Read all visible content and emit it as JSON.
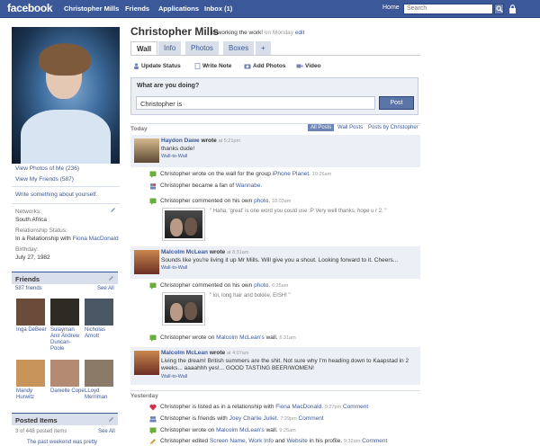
{
  "topbar": {
    "logo": "facebook",
    "nav": [
      "Christopher Mills",
      "Friends",
      "Applications",
      "Inbox (1)"
    ],
    "home": "Home",
    "search_placeholder": "Search"
  },
  "left": {
    "links": [
      "View Photos of Me (236)",
      "View My Friends (587)"
    ],
    "write_about": "Write something about yourself.",
    "networks_label": "Networks:",
    "networks_value": "South Africa",
    "relationship_label": "Relationship Status:",
    "relationship_value": "In a Relationship with",
    "relationship_partner": "Fiona MacDonald",
    "birthday_label": "Birthday:",
    "birthday_value": "July 27, 1982",
    "friends_title": "Friends",
    "friends_count": "587 friends",
    "friends_seeall": "See All",
    "friends": [
      {
        "name": "Inga DeBeer",
        "color": "#6b4b3a"
      },
      {
        "name": "Sulayman Anir Andrew Duncan-Poole",
        "color": "#2e2a24"
      },
      {
        "name": "Nicholas Arnott",
        "color": "#4a5866"
      },
      {
        "name": "Mandy Hurwitz",
        "color": "#c8945a"
      },
      {
        "name": "Danielle Cope",
        "color": "#b58a73"
      },
      {
        "name": "LLoyd Merriman",
        "color": "#8c7a68"
      }
    ],
    "posted_title": "Posted Items",
    "posted_count": "3 of 448 posted items",
    "posted_seeall": "See All",
    "posted_item": "The past weekend was pretty"
  },
  "main": {
    "name": "Christopher Mills",
    "status_text": "is working the work!",
    "status_time": "on Monday",
    "status_edit": "edit",
    "tabs": [
      "Wall",
      "Info",
      "Photos",
      "Boxes",
      "+"
    ],
    "publisher_tabs": [
      "Update Status",
      "Write Note",
      "Add Photos",
      "Video"
    ],
    "publisher_question": "What are you doing?",
    "publisher_value": "Christopher  is",
    "publisher_button": "Post",
    "today": "Today",
    "yesterday": "Yesterday",
    "filters": [
      "All Posts",
      "Wall Posts",
      "Posts by Christopher"
    ],
    "story1": {
      "who": "Haydon Dawe",
      "verb": "wrote",
      "time": "at 5:21pm",
      "text": "thanks dude!",
      "sub": "Wall-to-Wall"
    },
    "mini1": {
      "pre": "Christopher wrote on the wall for the group",
      "link": "iPhone Planet.",
      "time": "10:26am"
    },
    "mini2": {
      "pre": "Christopher became a fan of",
      "link": "Wannabe.",
      "time": ""
    },
    "mini3": {
      "pre": "Christopher commented on his own",
      "link": "photo.",
      "time": "10:03am"
    },
    "comment1": "\" Haha, 'great' is one word you could use :P Very well thanks, hope u r 2.  \"",
    "story2": {
      "who": "Malcolm McLean",
      "verb": "wrote",
      "time": "at 8:31am",
      "text": "Sounds like you're living it up Mr Mills. Will give you a shout. Looking forward to it. Cheers...",
      "sub": "Wall-to-Wall"
    },
    "mini4": {
      "pre": "Christopher commented on his own",
      "link": "photo.",
      "time": "6:25am"
    },
    "comment2": "\" lol, long hair and bokkie, EISH! \"",
    "mini5": {
      "pre": "Christopher wrote on",
      "link": "Malcolm McLean's",
      "post": "wall.",
      "time": "6:31am"
    },
    "story3": {
      "who": "Malcolm McLean",
      "verb": "wrote",
      "time": "at 4:07am",
      "text": "Living the dream! British summers are the shit. Not sure why I'm heading down to Kaapstad in 2 weeks... aaaahhh yes!... GOOD TASTING BEER/WOMEN!",
      "sub": "Wall-to-Wall"
    },
    "mini6": {
      "pre": "Christopher is listed as in a relationship with",
      "link": "Fiona MacDonald.",
      "time": "9:27pm",
      "action": "Comment"
    },
    "mini7": {
      "pre": "Christopher is friends with",
      "link": "Joey Charlie Juliet.",
      "time": "7:29pm",
      "action": "Comment"
    },
    "mini8": {
      "pre": "Christopher wrote on",
      "link": "Malcolm McLean's",
      "post": "wall.",
      "time": "9:25am"
    },
    "mini9": {
      "pre": "Christopher edited",
      "link": "Screen Name, Work Info",
      "mid": "and",
      "link2": "Website",
      "post": "in his profile.",
      "time": "9:32am",
      "action": "Comment"
    }
  },
  "colors": {
    "brand": "#3b5998",
    "highlight": "#eceff5",
    "border": "#d8dfea"
  }
}
